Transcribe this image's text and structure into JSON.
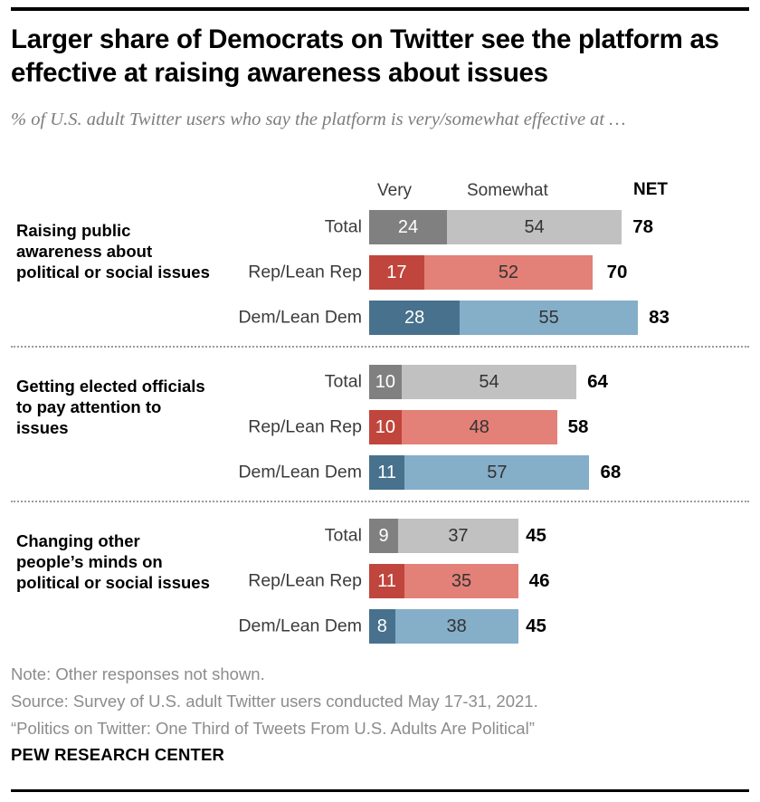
{
  "title": "Larger share of Democrats on Twitter see the platform as effective at raising awareness about issues",
  "subtitle": "% of U.S. adult Twitter users who say the platform is very/somewhat effective at …",
  "headers": {
    "very": "Very",
    "somewhat": "Somewhat",
    "net": "NET"
  },
  "notes": {
    "note": "Note: Other responses not shown.",
    "source": "Source: Survey of U.S. adult Twitter users conducted May 17-31, 2021.",
    "report": "“Politics on Twitter: One Third of Tweets From U.S. Adults Are Political”"
  },
  "brand": "PEW RESEARCH CENTER",
  "colors": {
    "very_total": "#808080",
    "somewhat_total": "#c1c1c1",
    "very_rep": "#c0453c",
    "somewhat_rep": "#e38078",
    "very_dem": "#47718c",
    "somewhat_dem": "#85aec8"
  },
  "chart_data": {
    "type": "bar",
    "subtype": "stacked-horizontal",
    "title": "Larger share of Democrats on Twitter see the platform as effective at raising awareness about issues",
    "subtitle": "% of U.S. adult Twitter users who say the platform is very/somewhat effective at …",
    "xlabel": "",
    "ylabel": "",
    "xlim": [
      0,
      83
    ],
    "grid": false,
    "legend_position": "top",
    "series": [
      {
        "name": "Very",
        "values": [
          24,
          17,
          28,
          10,
          10,
          11,
          9,
          11,
          8
        ]
      },
      {
        "name": "Somewhat",
        "values": [
          54,
          52,
          55,
          54,
          48,
          57,
          37,
          35,
          38
        ]
      }
    ],
    "net": [
      78,
      70,
      83,
      64,
      58,
      68,
      45,
      46,
      45
    ],
    "categories": [
      "Raising public awareness about political or social issues — Total",
      "Raising public awareness about political or social issues — Rep/Lean Rep",
      "Raising public awareness about political or social issues — Dem/Lean Dem",
      "Getting elected officials to pay attention to issues — Total",
      "Getting elected officials to pay attention to issues — Rep/Lean Rep",
      "Getting elected officials to pay attention to issues — Dem/Lean Dem",
      "Changing other people’s minds on political or social issues — Total",
      "Changing other people’s minds on political or social issues — Rep/Lean Rep",
      "Changing other people’s minds on political or social issues — Dem/Lean Dem"
    ],
    "groups": [
      {
        "label": "Raising public awareness about political or social issues",
        "rows": [
          {
            "label": "Total",
            "party": "total",
            "very": 24,
            "somewhat": 54,
            "net": 78
          },
          {
            "label": "Rep/Lean Rep",
            "party": "rep",
            "very": 17,
            "somewhat": 52,
            "net": 70
          },
          {
            "label": "Dem/Lean Dem",
            "party": "dem",
            "very": 28,
            "somewhat": 55,
            "net": 83
          }
        ]
      },
      {
        "label": "Getting elected officials to pay attention to issues",
        "rows": [
          {
            "label": "Total",
            "party": "total",
            "very": 10,
            "somewhat": 54,
            "net": 64
          },
          {
            "label": "Rep/Lean Rep",
            "party": "rep",
            "very": 10,
            "somewhat": 48,
            "net": 58
          },
          {
            "label": "Dem/Lean Dem",
            "party": "dem",
            "very": 11,
            "somewhat": 57,
            "net": 68
          }
        ]
      },
      {
        "label": "Changing other people’s minds on political or social issues",
        "rows": [
          {
            "label": "Total",
            "party": "total",
            "very": 9,
            "somewhat": 37,
            "net": 45
          },
          {
            "label": "Rep/Lean Rep",
            "party": "rep",
            "very": 11,
            "somewhat": 35,
            "net": 46
          },
          {
            "label": "Dem/Lean Dem",
            "party": "dem",
            "very": 8,
            "somewhat": 38,
            "net": 45
          }
        ]
      }
    ]
  }
}
